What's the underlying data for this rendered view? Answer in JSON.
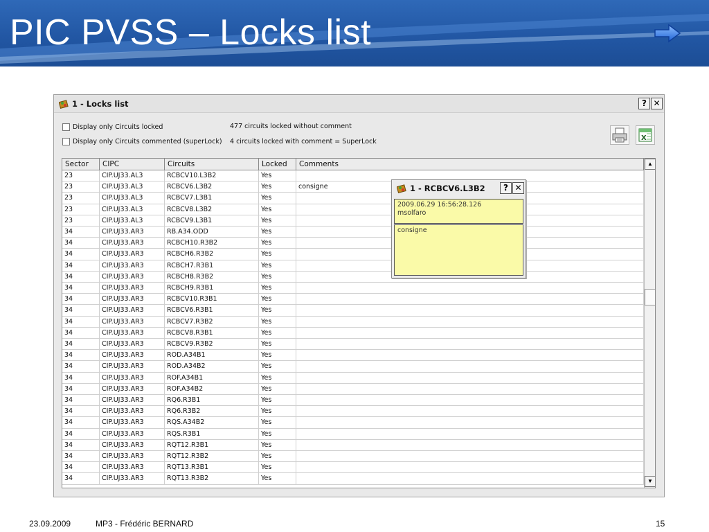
{
  "slide": {
    "title": "PIC PVSS – Locks list",
    "footer_date": "23.09.2009",
    "footer_author": "MP3 - Frédéric BERNARD",
    "page_number": "15"
  },
  "window": {
    "title": "1 - Locks list",
    "help_label": "?",
    "close_label": "✕",
    "option1_label": "Display only Circuits locked",
    "option2_label": "Display only Circuits commented (superLock)",
    "info1": "477 circuits locked without comment",
    "info2": "4 circuits locked with comment = SuperLock"
  },
  "table": {
    "columns": [
      "Sector",
      "CIPC",
      "Circuits",
      "Locked",
      "Comments"
    ],
    "rows": [
      [
        "23",
        "CIP.UJ33.AL3",
        "RCBCV10.L3B2",
        "Yes",
        ""
      ],
      [
        "23",
        "CIP.UJ33.AL3",
        "RCBCV6.L3B2",
        "Yes",
        "consigne"
      ],
      [
        "23",
        "CIP.UJ33.AL3",
        "RCBCV7.L3B1",
        "Yes",
        ""
      ],
      [
        "23",
        "CIP.UJ33.AL3",
        "RCBCV8.L3B2",
        "Yes",
        ""
      ],
      [
        "23",
        "CIP.UJ33.AL3",
        "RCBCV9.L3B1",
        "Yes",
        ""
      ],
      [
        "34",
        "CIP.UJ33.AR3",
        "RB.A34.ODD",
        "Yes",
        ""
      ],
      [
        "34",
        "CIP.UJ33.AR3",
        "RCBCH10.R3B2",
        "Yes",
        ""
      ],
      [
        "34",
        "CIP.UJ33.AR3",
        "RCBCH6.R3B2",
        "Yes",
        ""
      ],
      [
        "34",
        "CIP.UJ33.AR3",
        "RCBCH7.R3B1",
        "Yes",
        ""
      ],
      [
        "34",
        "CIP.UJ33.AR3",
        "RCBCH8.R3B2",
        "Yes",
        ""
      ],
      [
        "34",
        "CIP.UJ33.AR3",
        "RCBCH9.R3B1",
        "Yes",
        ""
      ],
      [
        "34",
        "CIP.UJ33.AR3",
        "RCBCV10.R3B1",
        "Yes",
        ""
      ],
      [
        "34",
        "CIP.UJ33.AR3",
        "RCBCV6.R3B1",
        "Yes",
        ""
      ],
      [
        "34",
        "CIP.UJ33.AR3",
        "RCBCV7.R3B2",
        "Yes",
        ""
      ],
      [
        "34",
        "CIP.UJ33.AR3",
        "RCBCV8.R3B1",
        "Yes",
        ""
      ],
      [
        "34",
        "CIP.UJ33.AR3",
        "RCBCV9.R3B2",
        "Yes",
        ""
      ],
      [
        "34",
        "CIP.UJ33.AR3",
        "ROD.A34B1",
        "Yes",
        ""
      ],
      [
        "34",
        "CIP.UJ33.AR3",
        "ROD.A34B2",
        "Yes",
        ""
      ],
      [
        "34",
        "CIP.UJ33.AR3",
        "ROF.A34B1",
        "Yes",
        ""
      ],
      [
        "34",
        "CIP.UJ33.AR3",
        "ROF.A34B2",
        "Yes",
        ""
      ],
      [
        "34",
        "CIP.UJ33.AR3",
        "RQ6.R3B1",
        "Yes",
        ""
      ],
      [
        "34",
        "CIP.UJ33.AR3",
        "RQ6.R3B2",
        "Yes",
        ""
      ],
      [
        "34",
        "CIP.UJ33.AR3",
        "RQS.A34B2",
        "Yes",
        ""
      ],
      [
        "34",
        "CIP.UJ33.AR3",
        "RQS.R3B1",
        "Yes",
        ""
      ],
      [
        "34",
        "CIP.UJ33.AR3",
        "RQT12.R3B1",
        "Yes",
        ""
      ],
      [
        "34",
        "CIP.UJ33.AR3",
        "RQT12.R3B2",
        "Yes",
        ""
      ],
      [
        "34",
        "CIP.UJ33.AR3",
        "RQT13.R3B1",
        "Yes",
        ""
      ],
      [
        "34",
        "CIP.UJ33.AR3",
        "RQT13.R3B2",
        "Yes",
        ""
      ]
    ]
  },
  "popup": {
    "title": "1 - RCBCV6.L3B2",
    "help_label": "?",
    "close_label": "✕",
    "timestamp": "2009.06.29 16:56:28.126",
    "user": "msolfaro",
    "comment": "consigne"
  },
  "icons": {
    "nav_arrow": "right-arrow-icon",
    "window_icon": "panel-icon",
    "print": "printer-icon",
    "excel": "excel-icon"
  },
  "colors": {
    "header_blue": "#2257a4",
    "note_yellow": "#fafaa8",
    "nav_arrow_blue": "#3a86e8"
  }
}
